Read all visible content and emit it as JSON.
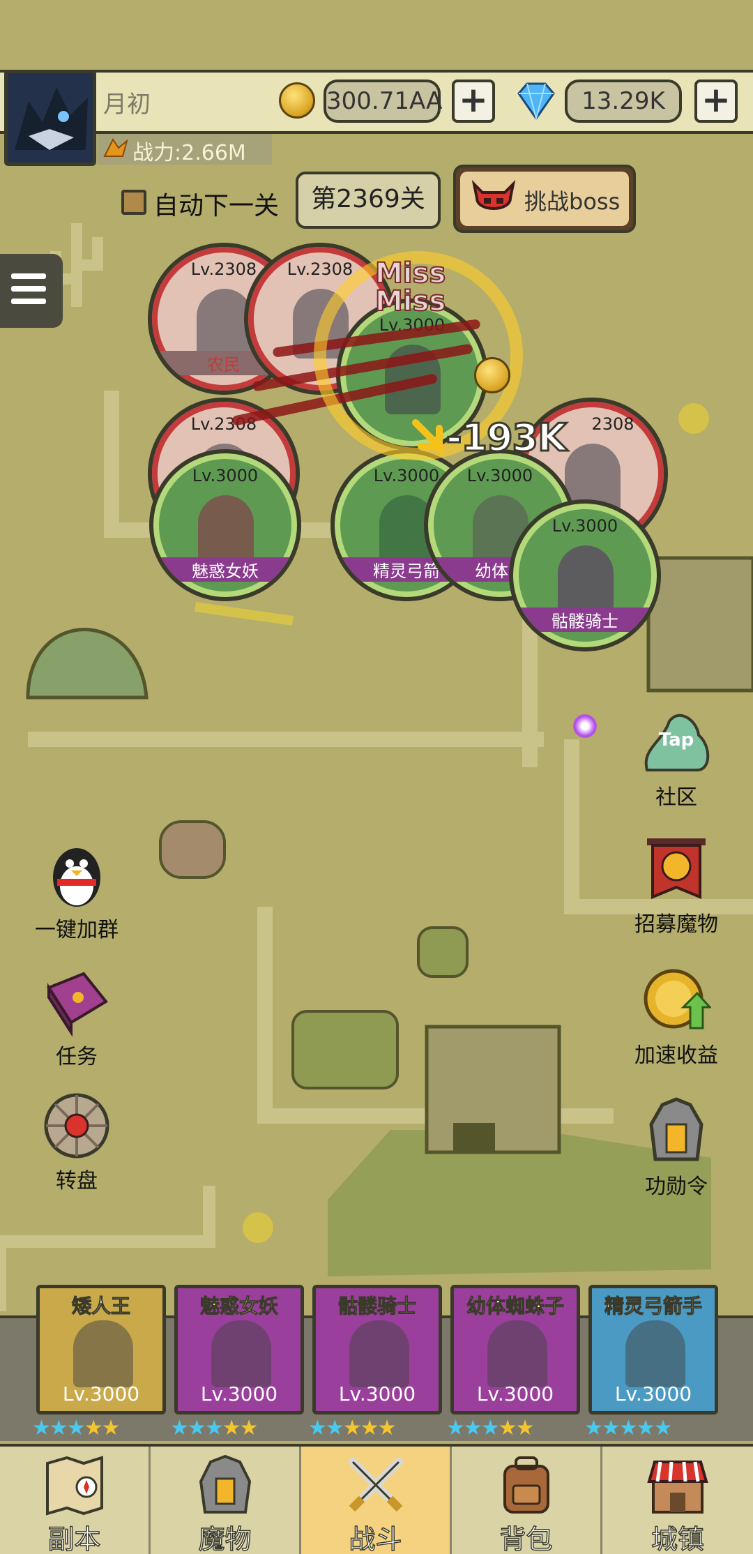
{
  "player": {
    "name": "月初",
    "power": "战力:2.66M",
    "gold": "300.71AA",
    "gems": "13.29K"
  },
  "stage": {
    "auto_next_label": "自动下一关",
    "current_stage": "第2369关",
    "boss_button": "挑战boss"
  },
  "battle": {
    "miss_1": "Miss",
    "miss_2": "Miss",
    "damage": "-193K",
    "enemies": [
      {
        "level": "Lv.2308",
        "label": "农民"
      },
      {
        "level": "Lv.2308",
        "label": ""
      },
      {
        "level": "Lv.2308",
        "label": ""
      },
      {
        "level": "2308",
        "label": ""
      }
    ],
    "allies": [
      {
        "level": "Lv.3000",
        "label": ""
      },
      {
        "level": "Lv.3000",
        "label": "魅惑女妖"
      },
      {
        "level": "Lv.3000",
        "label": "精灵弓箭"
      },
      {
        "level": "Lv.3000",
        "label": "幼体蜘"
      },
      {
        "level": "Lv.3000",
        "label": "骷髅骑士"
      }
    ]
  },
  "side_buttons": {
    "community": "社区",
    "community_tap": "Tap",
    "join_group": "一键加群",
    "recruit": "招募魔物",
    "tasks": "任务",
    "speed_up": "加速收益",
    "wheel": "转盘",
    "merit": "功勋令"
  },
  "team": [
    {
      "name": "矮人王",
      "level": "Lv.3000",
      "color": "#c9a94a",
      "stars": [
        "b",
        "b",
        "b",
        "g",
        "g"
      ]
    },
    {
      "name": "魅惑女妖",
      "level": "Lv.3000",
      "color": "#9a3f9c",
      "stars": [
        "b",
        "b",
        "b",
        "g",
        "g"
      ]
    },
    {
      "name": "骷髅骑士",
      "level": "Lv.3000",
      "color": "#9a3f9c",
      "stars": [
        "b",
        "b",
        "g",
        "g",
        "g"
      ]
    },
    {
      "name": "幼体蜘蛛子",
      "level": "Lv.3000",
      "color": "#9a3f9c",
      "stars": [
        "b",
        "b",
        "b",
        "g",
        "g"
      ]
    },
    {
      "name": "精灵弓箭手",
      "level": "Lv.3000",
      "color": "#4b9ac4",
      "stars": [
        "b",
        "b",
        "b",
        "b",
        "b"
      ]
    }
  ],
  "nav": [
    {
      "label": "副本",
      "active": false
    },
    {
      "label": "魔物",
      "active": false
    },
    {
      "label": "战斗",
      "active": true
    },
    {
      "label": "背包",
      "active": false
    },
    {
      "label": "城镇",
      "active": false
    }
  ]
}
